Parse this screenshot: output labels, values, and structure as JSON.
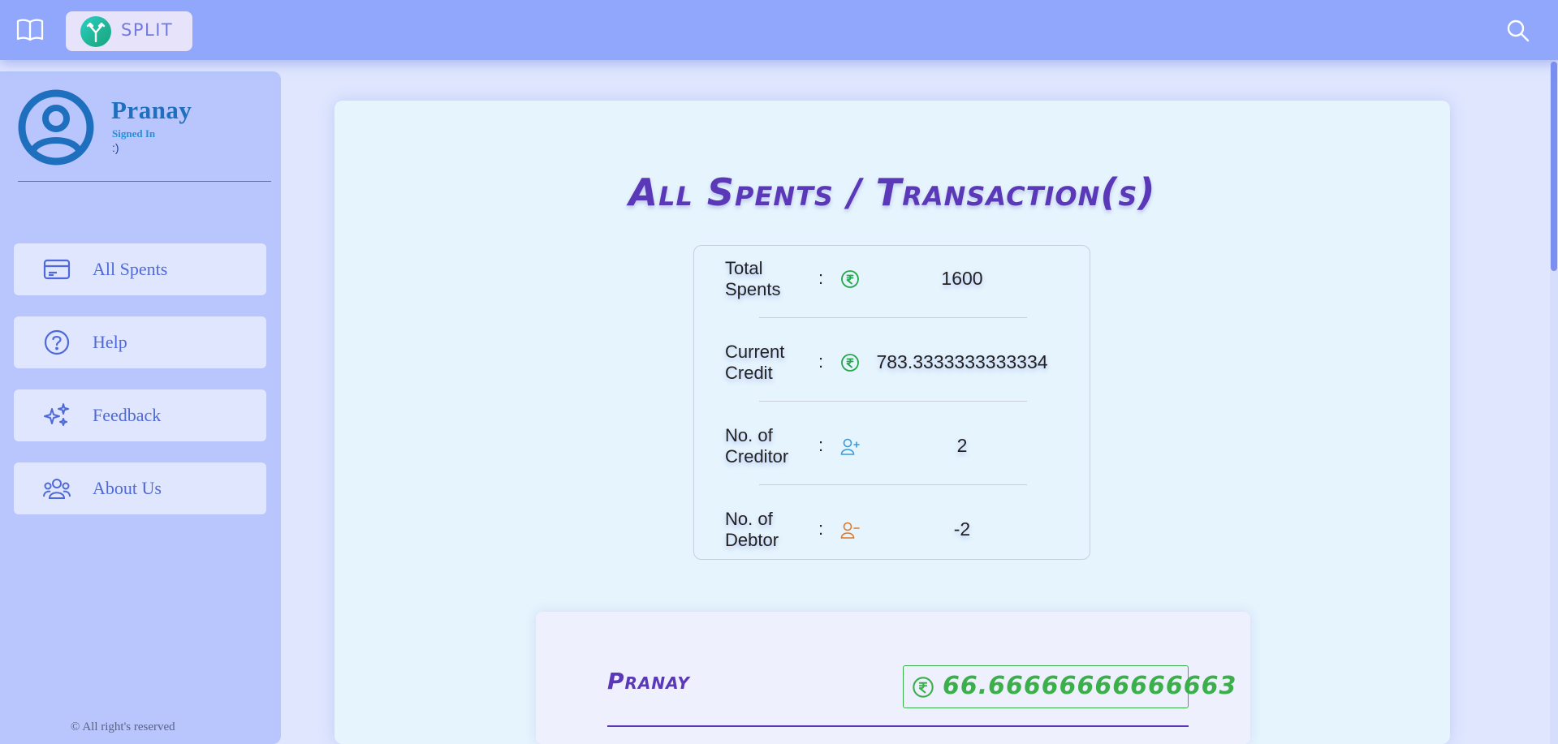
{
  "topbar": {
    "brand_name": "SPLIT",
    "menu_icon": "book-icon",
    "search_icon": "search-icon"
  },
  "sidebar": {
    "user": {
      "name": "Pranay",
      "status": "Signed In",
      "smile": ":)"
    },
    "items": [
      {
        "label": "All Spents",
        "icon": "credit-card-icon"
      },
      {
        "label": "Help",
        "icon": "question-circle-icon"
      },
      {
        "label": "Feedback",
        "icon": "sparkles-icon"
      },
      {
        "label": "About Us",
        "icon": "people-icon"
      }
    ],
    "copyright": "© All right's reserved"
  },
  "main": {
    "title": "All Spents / Transaction(s)",
    "summary": [
      {
        "label": "Total Spents",
        "colon": ":",
        "icon": "rupee-icon",
        "value": "1600"
      },
      {
        "label": "Current Credit",
        "colon": ":",
        "icon": "rupee-icon",
        "value": "783.3333333333334"
      },
      {
        "label": "No. of Creditor",
        "colon": ":",
        "icon": "person-plus-icon",
        "value": "2"
      },
      {
        "label": "No. of Debtor",
        "colon": ":",
        "icon": "person-minus-icon",
        "value": "-2"
      }
    ],
    "person": {
      "name": "Pranay",
      "amount": "66.66666666666663",
      "icon": "rupee-icon"
    }
  },
  "colors": {
    "topbar": "#91a7fc",
    "sidebar": "#b8c6fd",
    "accent_purple": "#5a38b8",
    "accent_green": "#3aaf4a",
    "nav_text": "#4f6ad8"
  }
}
